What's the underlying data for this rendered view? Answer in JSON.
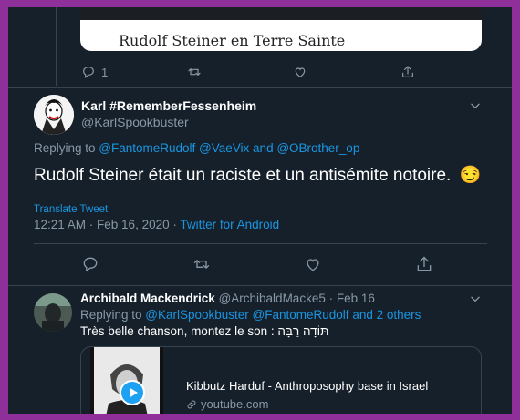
{
  "top_card": {
    "title": "Rudolf Steiner en Terre Sainte"
  },
  "top_actions": {
    "reply_count": "1"
  },
  "tweet": {
    "display_name": "Karl #RememberFessenheim",
    "handle": "@KarlSpookbuster",
    "replying_prefix": "Replying to ",
    "replying_users": "@FantomeRudolf @VaeVix",
    "replying_and": " and ",
    "replying_last": "@OBrother_op",
    "text": "Rudolf Steiner était un raciste et un antisémite notoire.",
    "emoji": "😏",
    "translate_label": "Translate Tweet",
    "timestamp": "12:21 AM · Feb 16, 2020 · ",
    "source": "Twitter for Android"
  },
  "reply": {
    "display_name": "Archibald Mackendrick",
    "handle": "@ArchibaldMacke5",
    "dot": " · ",
    "date": "Feb 16",
    "replying_prefix": "Replying to ",
    "replying_users": "@KarlSpookbuster @FantomeRudolf",
    "replying_and": " and ",
    "replying_others": "2 others",
    "text": "Très belle chanson, montez le son : תּוֹדָה רַבָּה",
    "card_title": "Kibbutz Harduf - Anthroposophy base in Israel",
    "card_domain": "youtube.com"
  },
  "colors": {
    "background": "#15202b",
    "accent": "#1b95e0",
    "muted": "#8899a6",
    "border": "#8e2f9a"
  },
  "icons": [
    "reply-icon",
    "retweet-icon",
    "like-icon",
    "share-icon",
    "chevron-down-icon",
    "play-icon",
    "link-icon"
  ]
}
